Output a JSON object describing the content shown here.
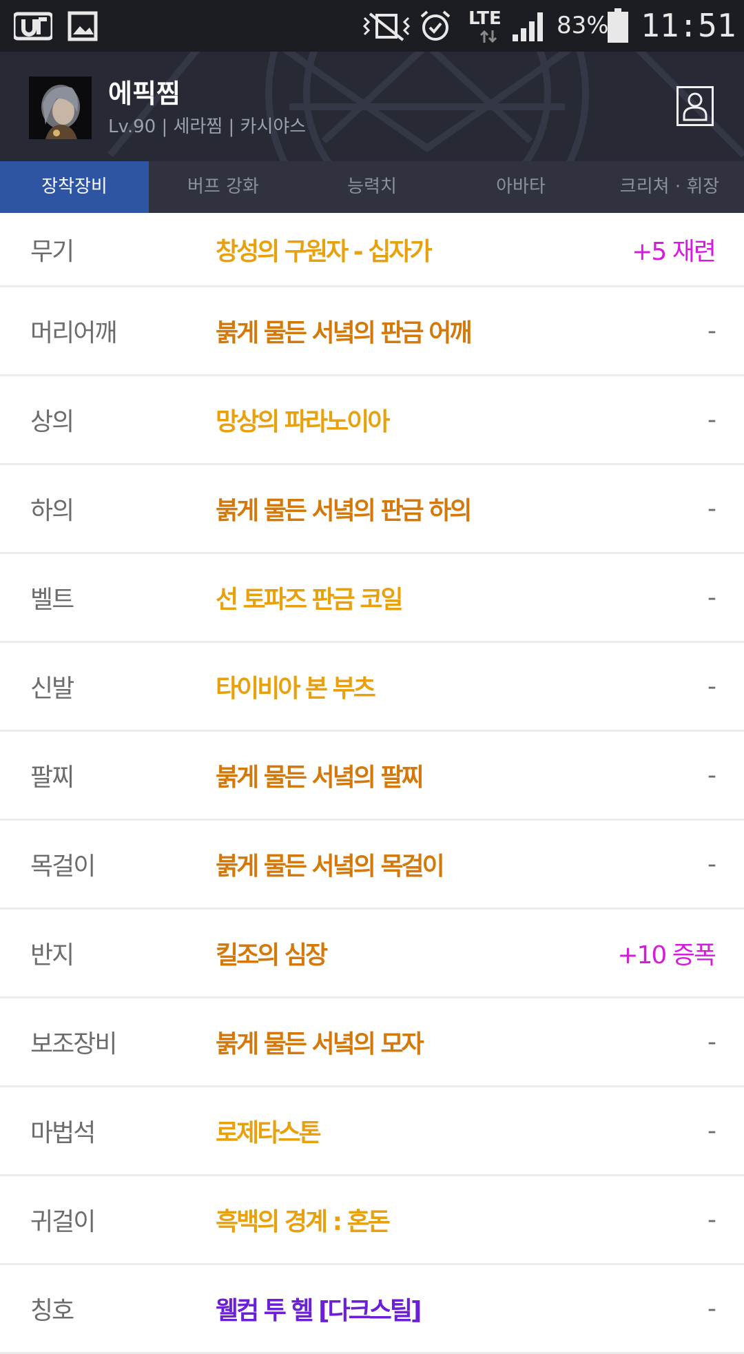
{
  "status_bar": {
    "network": "LTE",
    "battery": "83%",
    "time": "11:51"
  },
  "profile": {
    "name": "에픽찜",
    "subtitle": "Lv.90 | 세라찜 | 카시야스"
  },
  "tabs": [
    {
      "label": "장착장비",
      "active": true
    },
    {
      "label": "버프 강화",
      "active": false
    },
    {
      "label": "능력치",
      "active": false
    },
    {
      "label": "아바타",
      "active": false
    },
    {
      "label": "크리쳐 · 휘장",
      "active": false
    }
  ],
  "colors": {
    "legendary": "#e8a10d",
    "epic": "#d4780a",
    "rare": "#6b1fd6",
    "enchant": "#d51bdc"
  },
  "equipment": [
    {
      "slot": "무기",
      "item": "창성의 구원자 - 십자가",
      "enchant": "+5 재련",
      "rarity": "legendary"
    },
    {
      "slot": "머리어깨",
      "item": "붉게 물든 서녘의 판금 어깨",
      "enchant": "-",
      "rarity": "epic"
    },
    {
      "slot": "상의",
      "item": "망상의 파라노이아",
      "enchant": "-",
      "rarity": "legendary"
    },
    {
      "slot": "하의",
      "item": "붉게 물든 서녘의 판금 하의",
      "enchant": "-",
      "rarity": "epic"
    },
    {
      "slot": "벨트",
      "item": "선 토파즈 판금 코일",
      "enchant": "-",
      "rarity": "legendary"
    },
    {
      "slot": "신발",
      "item": "타이비아 본 부츠",
      "enchant": "-",
      "rarity": "legendary"
    },
    {
      "slot": "팔찌",
      "item": "붉게 물든 서녘의 팔찌",
      "enchant": "-",
      "rarity": "epic"
    },
    {
      "slot": "목걸이",
      "item": "붉게 물든 서녘의 목걸이",
      "enchant": "-",
      "rarity": "epic"
    },
    {
      "slot": "반지",
      "item": "킬조의 심장",
      "enchant": "+10 증폭",
      "rarity": "epic"
    },
    {
      "slot": "보조장비",
      "item": "붉게 물든 서녘의 모자",
      "enchant": "-",
      "rarity": "epic"
    },
    {
      "slot": "마법석",
      "item": "로제타스톤",
      "enchant": "-",
      "rarity": "legendary"
    },
    {
      "slot": "귀걸이",
      "item": "흑백의 경계 : 혼돈",
      "enchant": "-",
      "rarity": "legendary"
    },
    {
      "slot": "칭호",
      "item": "웰컴 투 헬 [다크스틸]",
      "enchant": "-",
      "rarity": "rare"
    }
  ]
}
